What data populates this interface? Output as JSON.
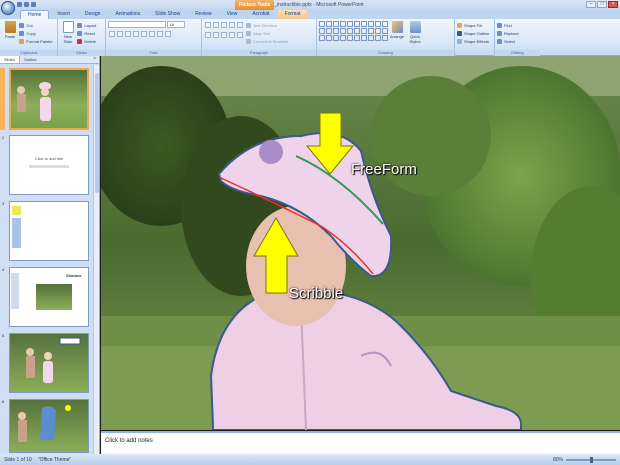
{
  "window": {
    "title": "invisible_instructible.pptx - Microsoft PowerPoint",
    "contextual_tab": "Picture Tools",
    "controls": [
      "–",
      "□",
      "×"
    ]
  },
  "tabs": [
    "Home",
    "Insert",
    "Design",
    "Animations",
    "Slide Show",
    "Review",
    "View",
    "Acrobat",
    "Format"
  ],
  "ribbon": {
    "clipboard": {
      "paste": "Paste",
      "cut": "Cut",
      "copy": "Copy",
      "format_painter": "Format Painter",
      "label": "Clipboard"
    },
    "slides": {
      "new_slide": "New Slide",
      "layout": "Layout",
      "reset": "Reset",
      "delete": "Delete",
      "label": "Slides"
    },
    "font": {
      "label": "Font",
      "size": "18"
    },
    "paragraph": {
      "text_direction": "Text Direction",
      "align_text": "Align Text",
      "convert_smartart": "Convert to SmartArt",
      "label": "Paragraph"
    },
    "drawing": {
      "arrange": "Arrange",
      "quick_styles": "Quick Styles",
      "shape_fill": "Shape Fill",
      "shape_outline": "Shape Outline",
      "shape_effects": "Shape Effects",
      "label": "Drawing"
    },
    "editing": {
      "find": "Find",
      "replace": "Replace",
      "select": "Select",
      "label": "Editing"
    }
  },
  "pane": {
    "tab_slides": "Slides",
    "tab_outline": "Outline",
    "close": "×"
  },
  "thumbnails": [
    {
      "num": "1",
      "caption": ""
    },
    {
      "num": "2",
      "caption": "Click to add title"
    },
    {
      "num": "3",
      "caption": ""
    },
    {
      "num": "4",
      "caption": "Shadow"
    },
    {
      "num": "5",
      "caption": ""
    },
    {
      "num": "6",
      "caption": ""
    }
  ],
  "slide": {
    "label_freeform": "FreeForm",
    "label_scribble": "Scribble",
    "colors": {
      "arrow_fill": "#ffff00",
      "freeform_line": "#2e9a5a",
      "scribble_line": "#e8332f",
      "outline": "#3a5a8c"
    }
  },
  "notes": {
    "placeholder": "Click to add notes"
  },
  "status": {
    "slide": "Slide 1 of 10",
    "theme": "\"Office Theme\"",
    "zoom": "80%"
  }
}
